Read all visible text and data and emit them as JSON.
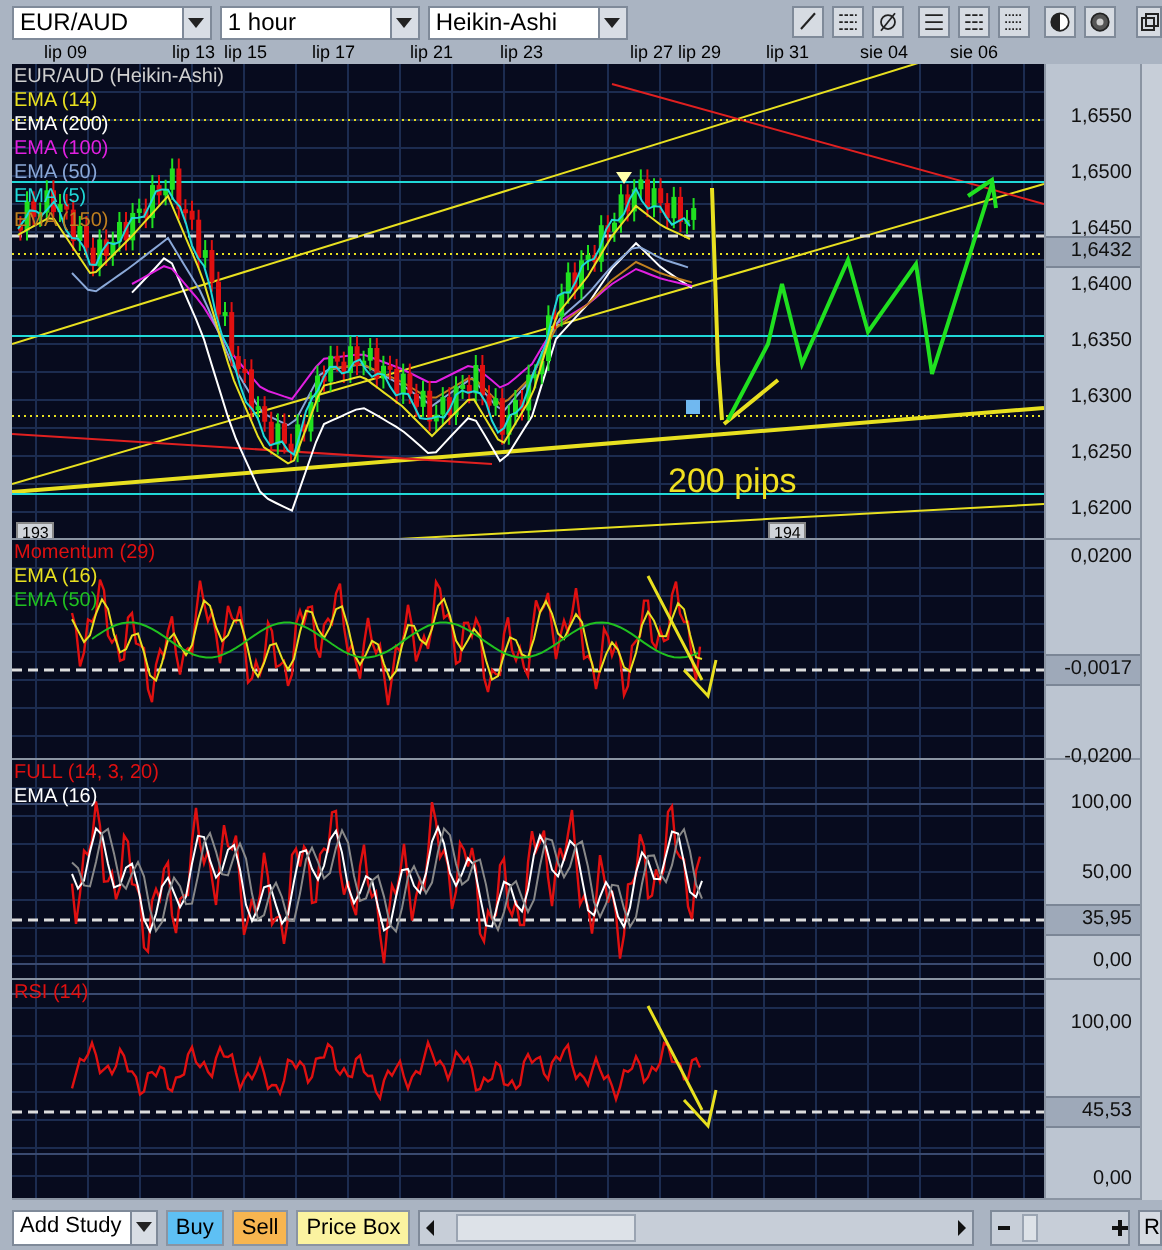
{
  "toolbar": {
    "symbol": "EUR/AUD",
    "interval": "1 hour",
    "chart_type": "Heikin-Ashi"
  },
  "date_axis": [
    "lip 09",
    "lip 13",
    "lip 15",
    "lip 17",
    "lip 21",
    "lip 23",
    "lip 27",
    "lip 29",
    "lip 31",
    "sie 04",
    "sie 06"
  ],
  "panels": [
    {
      "kind": "price",
      "legend": [
        {
          "text": "EUR/AUD (Heikin-Ashi)",
          "color": "#d0d0d0"
        },
        {
          "text": "EMA (14)",
          "color": "#e8e020"
        },
        {
          "text": "EMA (200)",
          "color": "#ffffff"
        },
        {
          "text": "EMA (100)",
          "color": "#e020e0"
        },
        {
          "text": "EMA (50)",
          "color": "#8aa8d8"
        },
        {
          "text": "EMA (5)",
          "color": "#20d8d8"
        },
        {
          "text": "EMA (150)",
          "color": "#c08020"
        }
      ],
      "axis_labels": [
        {
          "text": "1,6550",
          "current": false
        },
        {
          "text": "1,6500",
          "current": false
        },
        {
          "text": "1,6450",
          "current": false
        },
        {
          "text": "1,6432",
          "current": true
        },
        {
          "text": "1,6400",
          "current": false
        },
        {
          "text": "1,6350",
          "current": false
        },
        {
          "text": "1,6300",
          "current": false
        },
        {
          "text": "1,6250",
          "current": false
        },
        {
          "text": "1,6200",
          "current": false
        }
      ],
      "annotation": "200 pips",
      "bar_markers": [
        "193",
        "194"
      ]
    },
    {
      "kind": "momentum",
      "legend": [
        {
          "text": "Momentum (29)",
          "color": "#e01010"
        },
        {
          "text": "EMA (16)",
          "color": "#e8e020"
        },
        {
          "text": "EMA (50)",
          "color": "#20c020"
        }
      ],
      "axis_labels": [
        {
          "text": "0,0200",
          "current": false
        },
        {
          "text": "-0,0017",
          "current": true
        },
        {
          "text": "-0,0200",
          "current": false
        }
      ]
    },
    {
      "kind": "stochastic",
      "legend": [
        {
          "text": "FULL (14, 3, 20)",
          "color": "#e01010"
        },
        {
          "text": "EMA (16)",
          "color": "#ffffff"
        }
      ],
      "axis_labels": [
        {
          "text": "100,00",
          "current": false
        },
        {
          "text": "50,00",
          "current": false
        },
        {
          "text": "35,95",
          "current": true
        },
        {
          "text": "0,00",
          "current": false
        }
      ]
    },
    {
      "kind": "rsi",
      "legend": [
        {
          "text": "RSI (14)",
          "color": "#e01010"
        }
      ],
      "axis_labels": [
        {
          "text": "100,00",
          "current": false
        },
        {
          "text": "45,53",
          "current": true
        },
        {
          "text": "0,00",
          "current": false
        }
      ]
    }
  ],
  "bottom_bar": {
    "add_study": "Add Study",
    "buttons": [
      {
        "label": "Buy",
        "kind": "buy"
      },
      {
        "label": "Sell",
        "kind": "sell"
      },
      {
        "label": "Price Box",
        "kind": "pricebox"
      }
    ],
    "reset_label": "R"
  }
}
